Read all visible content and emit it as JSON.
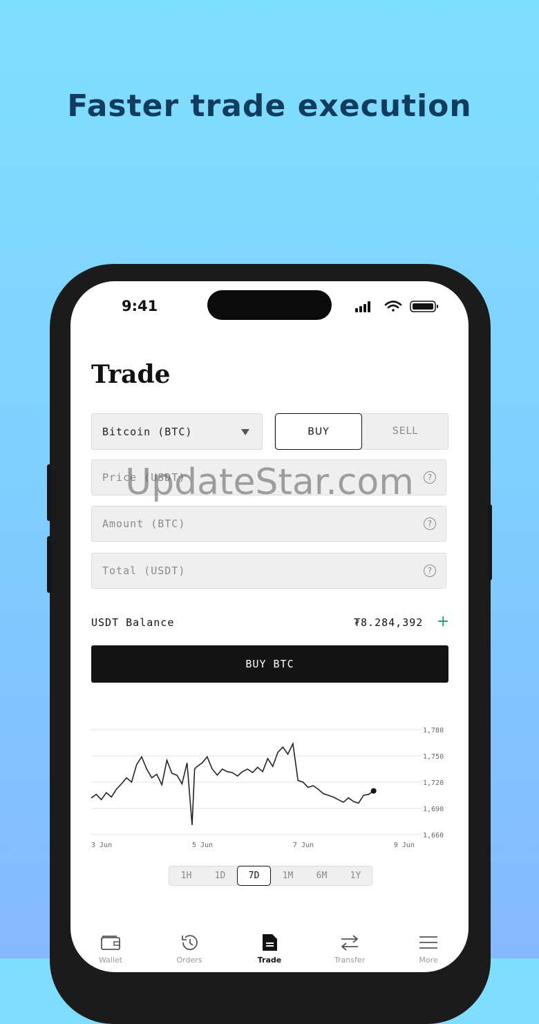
{
  "promo": {
    "headline": "Faster trade execution"
  },
  "status_bar": {
    "time": "9:41"
  },
  "page": {
    "title": "Trade"
  },
  "pair_select": {
    "value": "Bitcoin (BTC)"
  },
  "side_toggle": {
    "buy_label": "BUY",
    "sell_label": "SELL",
    "selected": "BUY"
  },
  "form": {
    "price_placeholder": "Price (USDT)",
    "amount_placeholder": "Amount (BTC)",
    "total_placeholder": "Total (USDT)"
  },
  "balance": {
    "label": "USDT Balance",
    "value": "₮8.284,392"
  },
  "action": {
    "label": "BUY BTC"
  },
  "chart_data": {
    "type": "line",
    "y_ticks": [
      "1,780",
      "1,750",
      "1,720",
      "1,690",
      "1,660"
    ],
    "x_ticks": [
      "3 Jun",
      "5 Jun",
      "7 Jun",
      "9 Jun"
    ],
    "ylim": [
      1660,
      1780
    ],
    "x": [
      3.0,
      3.1,
      3.2,
      3.3,
      3.4,
      3.5,
      3.6,
      3.7,
      3.8,
      3.9,
      4.0,
      4.1,
      4.2,
      4.3,
      4.4,
      4.5,
      4.6,
      4.7,
      4.8,
      4.9,
      5.0,
      5.05,
      5.1,
      5.2,
      5.3,
      5.4,
      5.5,
      5.6,
      5.7,
      5.8,
      5.9,
      6.0,
      6.1,
      6.2,
      6.3,
      6.4,
      6.5,
      6.6,
      6.7,
      6.8,
      6.9,
      7.0,
      7.1,
      7.2,
      7.3,
      7.4,
      7.5,
      7.6,
      7.7,
      7.8,
      7.9,
      8.0,
      8.1,
      8.2,
      8.3,
      8.4,
      8.5,
      8.6,
      8.7,
      8.8,
      8.9,
      9.0,
      9.1,
      9.2
    ],
    "y": [
      1702,
      1706,
      1700,
      1708,
      1703,
      1712,
      1718,
      1725,
      1720,
      1740,
      1749,
      1735,
      1725,
      1729,
      1717,
      1745,
      1730,
      1728,
      1718,
      1742,
      1671,
      1735,
      1738,
      1742,
      1749,
      1735,
      1728,
      1735,
      1732,
      1731,
      1727,
      1732,
      1735,
      1731,
      1737,
      1732,
      1747,
      1738,
      1754,
      1760,
      1752,
      1764,
      1722,
      1720,
      1714,
      1716,
      1712,
      1707,
      1705,
      1703,
      1700,
      1697,
      1702,
      1698,
      1696,
      1705,
      1706,
      1710
    ],
    "series": [
      {
        "values": []
      }
    ],
    "grid": true,
    "axis_position": "right"
  },
  "range_selector": {
    "options": [
      "1H",
      "1D",
      "7D",
      "1M",
      "6M",
      "1Y"
    ],
    "selected": "7D"
  },
  "bottom_nav": {
    "items": [
      {
        "label": "Wallet",
        "icon": "wallet-icon"
      },
      {
        "label": "Orders",
        "icon": "history-icon"
      },
      {
        "label": "Trade",
        "icon": "document-icon"
      },
      {
        "label": "Transfer",
        "icon": "transfer-icon"
      },
      {
        "label": "More",
        "icon": "menu-icon"
      }
    ]
  },
  "watermark": {
    "text": "UpdateStar.com"
  }
}
